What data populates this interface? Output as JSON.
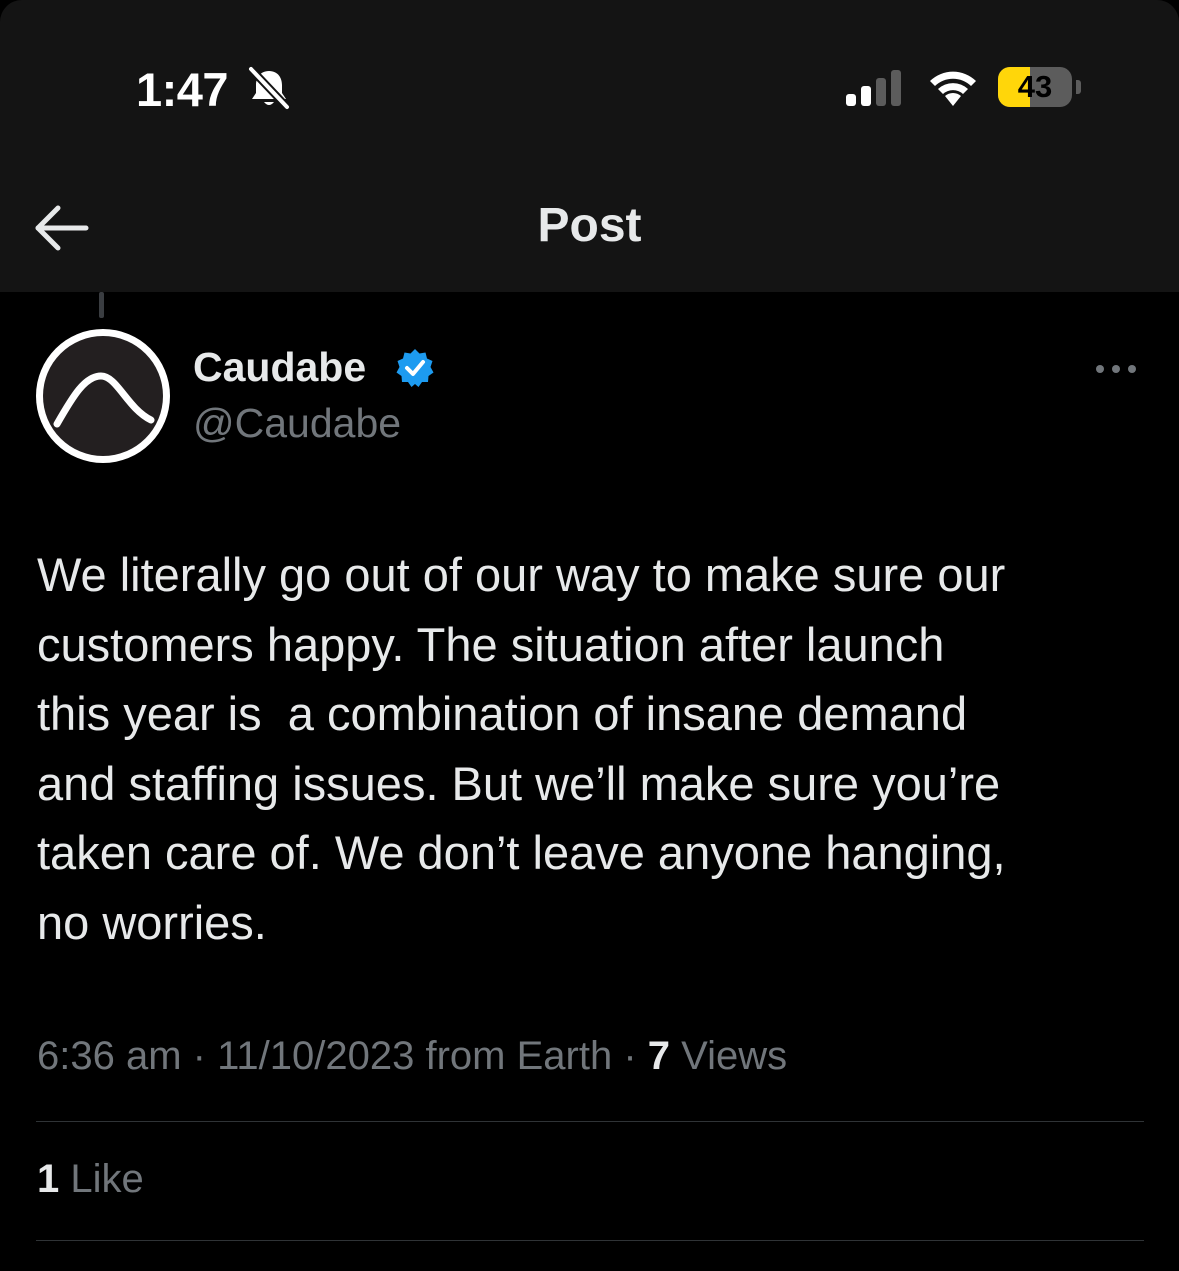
{
  "status_bar": {
    "time": "1:47",
    "battery_level": "43",
    "battery_fraction": 0.43,
    "icons": [
      "bell-slash-icon",
      "cellular-signal-icon",
      "wifi-icon",
      "battery-icon"
    ]
  },
  "header": {
    "title": "Post",
    "back_icon": "arrow-left-icon"
  },
  "post": {
    "author": {
      "display_name": "Caudabe",
      "handle": "@Caudabe",
      "verified": true,
      "verified_color": "#1d9bf0"
    },
    "text": "We literally go out of our way to make sure our\ncustomers happy. The situation after launch\nthis year is  a combination of insane demand\nand staffing issues. But we’ll make sure you’re\ntaken care of. We don’t leave anyone hanging,\nno worries.",
    "time": "6:36 am",
    "separator": "·",
    "date": "11/10/2023",
    "source": "from Earth",
    "views_count": "7",
    "views_label": "Views",
    "likes_count": "1",
    "likes_label": "Like"
  },
  "colors": {
    "background": "#000000",
    "header_background": "#141414",
    "primary_text": "#e7e9ea",
    "secondary_text": "#71767b",
    "divider": "#2f3336",
    "battery_fill": "#ffd60a"
  }
}
